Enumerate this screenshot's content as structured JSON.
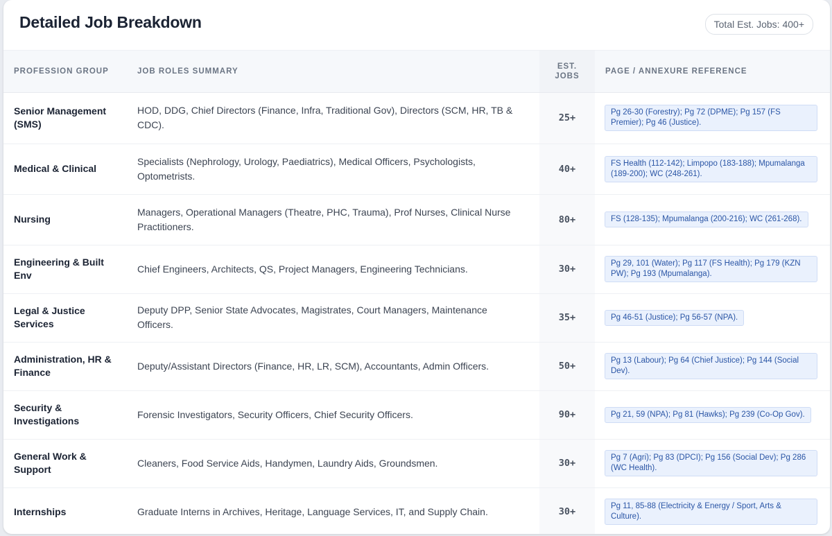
{
  "header": {
    "title": "Detailed Job Breakdown",
    "total_badge": "Total Est. Jobs: 400+"
  },
  "table": {
    "columns": {
      "group": "PROFESSION GROUP",
      "roles": "JOB ROLES SUMMARY",
      "jobs_line1": "EST.",
      "jobs_line2": "JOBS",
      "reference": "PAGE / ANNEXURE REFERENCE"
    },
    "rows": [
      {
        "group": "Senior Management (SMS)",
        "roles": "HOD, DDG, Chief Directors (Finance, Infra, Traditional Gov), Directors (SCM, HR, TB & CDC).",
        "jobs": "25+",
        "reference": "Pg 26-30 (Forestry); Pg 72 (DPME); Pg 157 (FS Premier); Pg 46 (Justice)."
      },
      {
        "group": "Medical & Clinical",
        "roles": "Specialists (Nephrology, Urology, Paediatrics), Medical Officers, Psychologists, Optometrists.",
        "jobs": "40+",
        "reference": "FS Health (112-142); Limpopo (183-188); Mpumalanga (189-200); WC (248-261)."
      },
      {
        "group": "Nursing",
        "roles": "Managers, Operational Managers (Theatre, PHC, Trauma), Prof Nurses, Clinical Nurse Practitioners.",
        "jobs": "80+",
        "reference": "FS (128-135); Mpumalanga (200-216); WC (261-268)."
      },
      {
        "group": "Engineering & Built Env",
        "roles": "Chief Engineers, Architects, QS, Project Managers, Engineering Technicians.",
        "jobs": "30+",
        "reference": "Pg 29, 101 (Water); Pg 117 (FS Health); Pg 179 (KZN PW); Pg 193 (Mpumalanga)."
      },
      {
        "group": "Legal & Justice Services",
        "roles": "Deputy DPP, Senior State Advocates, Magistrates, Court Managers, Maintenance Officers.",
        "jobs": "35+",
        "reference": "Pg 46-51 (Justice); Pg 56-57 (NPA)."
      },
      {
        "group": "Administration, HR & Finance",
        "roles": "Deputy/Assistant Directors (Finance, HR, LR, SCM), Accountants, Admin Officers.",
        "jobs": "50+",
        "reference": "Pg 13 (Labour); Pg 64 (Chief Justice); Pg 144 (Social Dev)."
      },
      {
        "group": "Security & Investigations",
        "roles": "Forensic Investigators, Security Officers, Chief Security Officers.",
        "jobs": "90+",
        "reference": "Pg 21, 59 (NPA); Pg 81 (Hawks); Pg 239 (Co-Op Gov)."
      },
      {
        "group": "General Work & Support",
        "roles": "Cleaners, Food Service Aids, Handymen, Laundry Aids, Groundsmen.",
        "jobs": "30+",
        "reference": "Pg 7 (Agri); Pg 83 (DPCI); Pg 156 (Social Dev); Pg 286 (WC Health)."
      },
      {
        "group": "Internships",
        "roles": "Graduate Interns in Archives, Heritage, Language Services, IT, and Supply Chain.",
        "jobs": "30+",
        "reference": "Pg 11, 85-88 (Electricity & Energy / Sport, Arts & Culture)."
      }
    ]
  }
}
